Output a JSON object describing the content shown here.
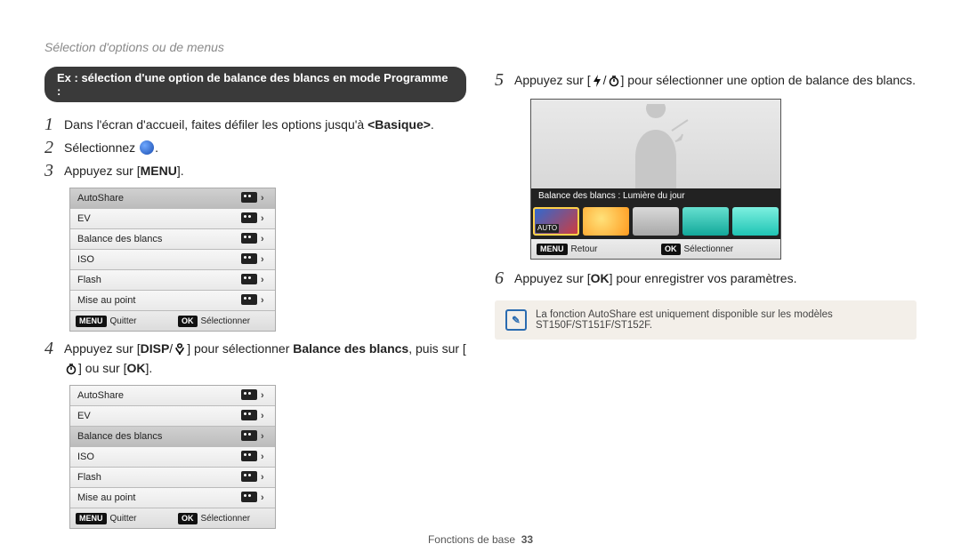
{
  "header": {
    "crumb": "Sélection d'options ou de menus"
  },
  "left": {
    "ex_banner": "Ex : sélection d'une option de balance des blancs en mode Programme :",
    "step1_a": "Dans l'écran d'accueil, faites défiler les options jusqu'à ",
    "step1_b": "<Basique>",
    "step1_c": ".",
    "step2": "Sélectionnez ",
    "step2_dot": ".",
    "step3_a": "Appuyez sur [",
    "step3_menu": "MENU",
    "step3_b": "].",
    "menu1": {
      "rows": [
        {
          "label": "AutoShare",
          "icon": "share-icon"
        },
        {
          "label": "EV",
          "icon": "ev-icon"
        },
        {
          "label": "Balance des blancs",
          "icon": "wb-icon"
        },
        {
          "label": "ISO",
          "icon": "iso-icon"
        },
        {
          "label": "Flash",
          "icon": "flash-icon"
        },
        {
          "label": "Mise au point",
          "icon": "focus-icon"
        }
      ],
      "foot_left_badge": "MENU",
      "foot_left": "Quitter",
      "foot_right_badge": "OK",
      "foot_right": "Sélectionner",
      "selected": 0
    },
    "step4_a": "Appuyez sur [",
    "step4_disp": "DISP",
    "step4_slash": "/",
    "step4_b": "] pour sélectionner ",
    "step4_bold": "Balance des blancs",
    "step4_c": ", puis sur [",
    "step4_d": "] ou sur [",
    "step4_ok": "OK",
    "step4_e": "].",
    "menu2": {
      "rows": [
        {
          "label": "AutoShare",
          "icon": "share-icon"
        },
        {
          "label": "EV",
          "icon": "ev-icon"
        },
        {
          "label": "Balance des blancs",
          "icon": "wb-icon"
        },
        {
          "label": "ISO",
          "icon": "iso-icon"
        },
        {
          "label": "Flash",
          "icon": "flash-icon"
        },
        {
          "label": "Mise au point",
          "icon": "focus-icon"
        }
      ],
      "foot_left_badge": "MENU",
      "foot_left": "Quitter",
      "foot_right_badge": "OK",
      "foot_right": "Sélectionner",
      "selected": 2
    }
  },
  "right": {
    "step5_a": "Appuyez sur [",
    "step5_slash": "/",
    "step5_b": "] pour sélectionner une option de balance des blancs.",
    "preview": {
      "wb_label": "Balance des blancs : Lumière du jour",
      "swatches": [
        {
          "name": "auto",
          "grad": "linear-gradient(135deg,#2a6bd6,#d43a3a)",
          "badge": "AUTO",
          "sel": true
        },
        {
          "name": "daylight",
          "grad": "radial-gradient(circle at 40% 40%,#ffe27a,#ff9a1f)"
        },
        {
          "name": "cloudy",
          "grad": "linear-gradient(#d9d9d9,#a8a8a8)"
        },
        {
          "name": "fluo-h",
          "grad": "linear-gradient(#66e0d0,#12a89a)"
        },
        {
          "name": "fluo-l",
          "grad": "linear-gradient(#7df0e0,#1fc4b4)"
        }
      ],
      "foot_left_badge": "MENU",
      "foot_left": "Retour",
      "foot_right_badge": "OK",
      "foot_right": "Sélectionner"
    },
    "step6_a": "Appuyez sur [",
    "step6_ok": "OK",
    "step6_b": "] pour enregistrer vos paramètres.",
    "note": "La fonction AutoShare est uniquement disponible sur les modèles ST150F/ST151F/ST152F."
  },
  "footer": {
    "section": "Fonctions de base",
    "page": "33"
  }
}
